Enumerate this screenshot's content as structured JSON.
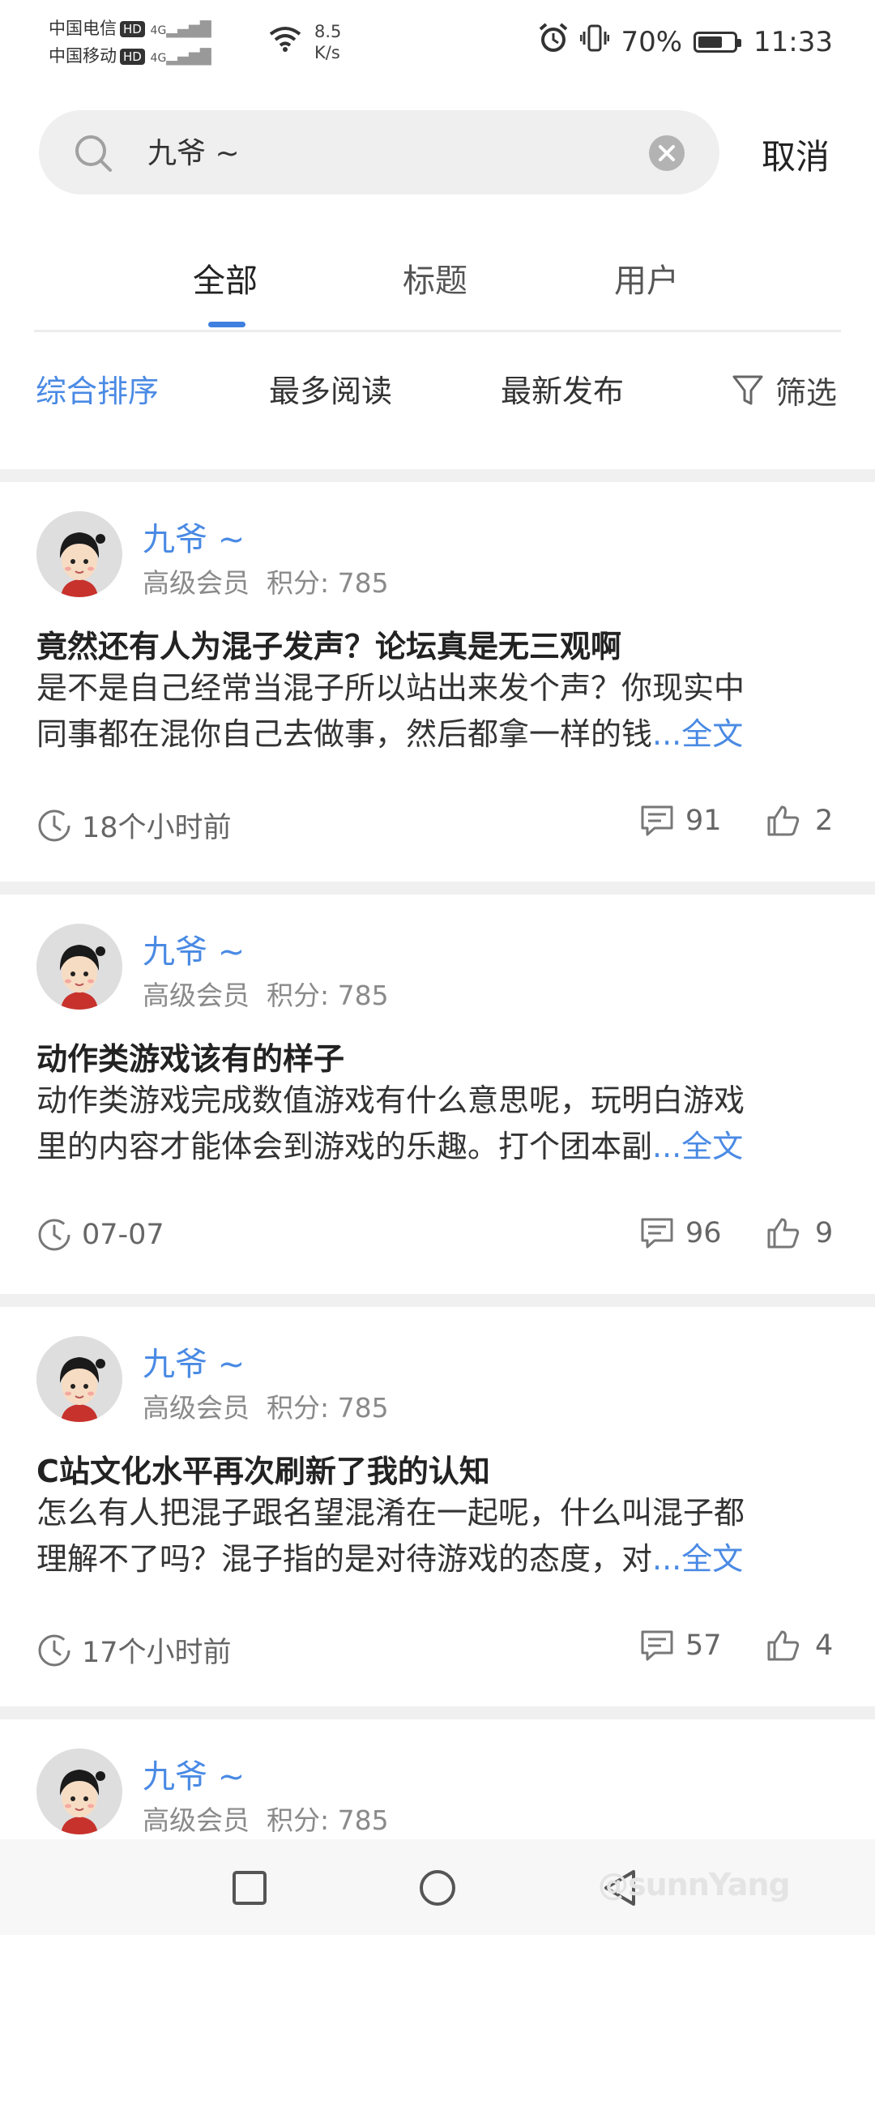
{
  "status": {
    "carrier1": "中国电信",
    "carrier2": "中国移动",
    "hd": "HD",
    "net": "4G",
    "speed_value": "8.5",
    "speed_unit": "K/s",
    "battery": "70%",
    "battery_level": 0.7,
    "time": "11:33"
  },
  "search": {
    "query": "九爷 ~",
    "cancel_label": "取消"
  },
  "tabs": [
    {
      "label": "全部",
      "active": true
    },
    {
      "label": "标题",
      "active": false
    },
    {
      "label": "用户",
      "active": false
    }
  ],
  "sort": {
    "options": [
      "综合排序",
      "最多阅读",
      "最新发布"
    ],
    "active_index": 0,
    "filter_label": "筛选"
  },
  "colors": {
    "accent": "#4a8ae4",
    "text": "#222222",
    "muted": "#8a8a8a"
  },
  "posts": [
    {
      "user": "九爷 ~",
      "level": "高级会员",
      "score": "积分: 785",
      "title": "竟然还有人为混子发声？论坛真是无三观啊",
      "line1": "是不是自己经常当混子所以站出来发个声？你现实中",
      "line2": "同事都在混你自己去做事，然后都拿一样的钱",
      "more": "...全文",
      "time": "18个小时前",
      "comments": "91",
      "likes": "2"
    },
    {
      "user": "九爷 ~",
      "level": "高级会员",
      "score": "积分: 785",
      "title": "动作类游戏该有的样子",
      "line1": "动作类游戏完成数值游戏有什么意思呢，玩明白游戏",
      "line2": "里的内容才能体会到游戏的乐趣。打个团本副",
      "more": "...全文",
      "time": "07-07",
      "comments": "96",
      "likes": "9"
    },
    {
      "user": "九爷 ~",
      "level": "高级会员",
      "score": "积分: 785",
      "title": "C站文化水平再次刷新了我的认知",
      "line1": "怎么有人把混子跟名望混淆在一起呢，什么叫混子都",
      "line2": "理解不了吗？混子指的是对待游戏的态度，对",
      "more": "...全文",
      "time": "17个小时前",
      "comments": "57",
      "likes": "4"
    },
    {
      "user": "九爷 ~",
      "level": "高级会员",
      "score": "积分: 785"
    }
  ],
  "watermark": "@sunnYang"
}
